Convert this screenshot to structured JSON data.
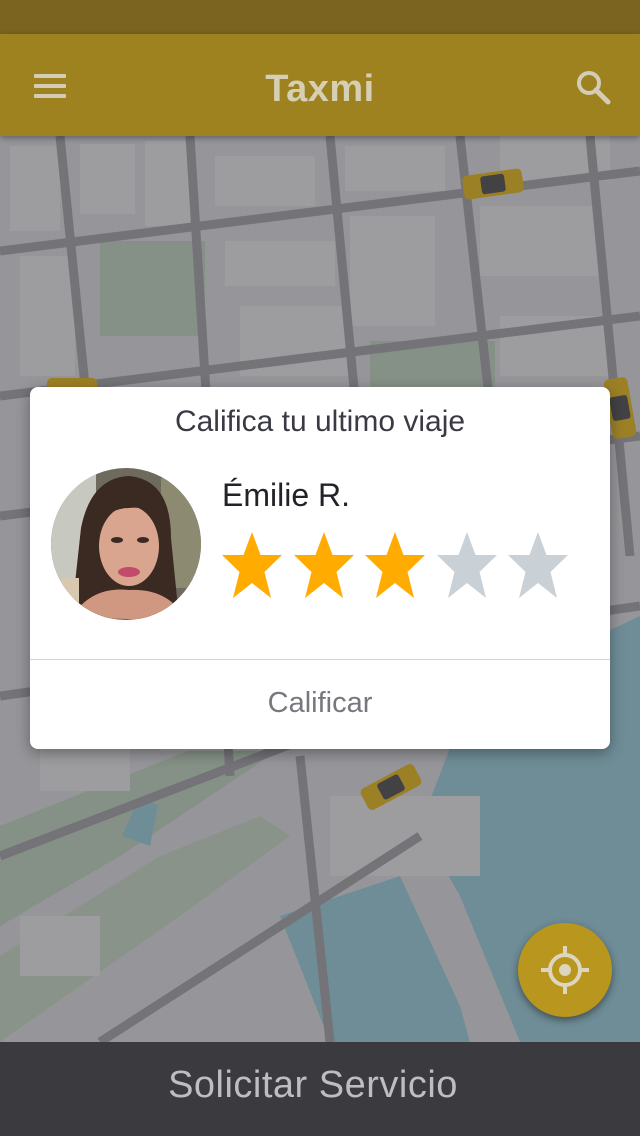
{
  "header": {
    "title": "Taxmi",
    "menu_icon": "hamburger-menu-icon",
    "search_icon": "search-icon"
  },
  "colors": {
    "header": "#9e8220",
    "accent": "#b9961e",
    "star_filled": "#ffab00",
    "star_empty": "#c9d1d6",
    "bottom_bar": "#3a3a3f"
  },
  "rating_dialog": {
    "title": "Califica tu ultimo viaje",
    "driver_name": "Émilie R.",
    "rating": 3,
    "max_rating": 5,
    "submit_label": "Calificar"
  },
  "locate_button": {
    "icon": "crosshair-locate-icon"
  },
  "bottom_bar": {
    "label": "Solicitar Servicio"
  }
}
